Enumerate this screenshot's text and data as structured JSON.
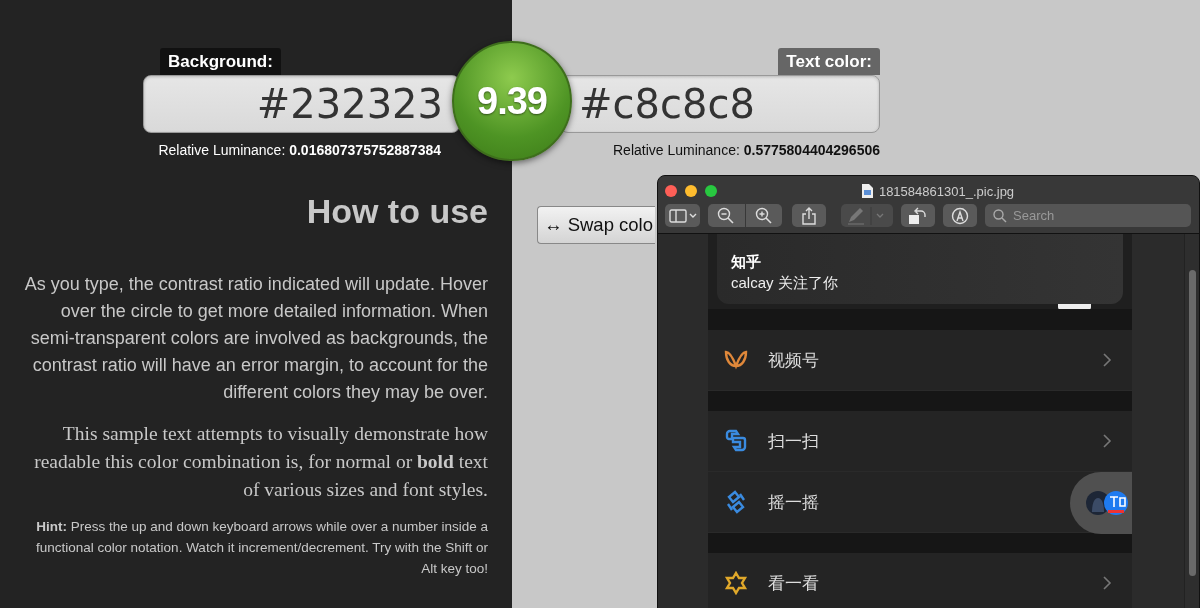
{
  "contrast": {
    "ratio": "9.39",
    "background": {
      "label": "Background:",
      "value": "#232323",
      "luminance": "Relative Luminance: **0.016807375752887384**"
    },
    "text_color": {
      "label": "Text color:",
      "value": "#c8c8c8",
      "luminance": "Relative Luminance: **0.5775804404296506**"
    }
  },
  "how_to_use": {
    "heading": "How to use",
    "paragraph": "As you type, the contrast ratio indicated will update. Hover over the circle to get more detailed information. When semi-transparent colors are involved as backgrounds, the contrast ratio will have an error margin, to account for the different colors they may be over.",
    "sample": "This sample text attempts to visually demonstrate how readable this color combination is, for normal or **bold** text of various sizes and font styles.",
    "hint": "**Hint:** Press the up and down keyboard arrows while over a number inside a functional color notation. Watch it increment/decrement. Try with the Shift or Alt key too!"
  },
  "swap_button": "↔ Swap colo",
  "preview_window": {
    "title": "181584861301_.pic.jpg",
    "toolbar": [
      {
        "kind": "sidebar",
        "disabled": false
      },
      {
        "kind": "zoom-out",
        "disabled": false
      },
      {
        "kind": "zoom-in",
        "disabled": false
      },
      {
        "kind": "share",
        "disabled": false
      },
      {
        "kind": "markup",
        "disabled": true
      },
      {
        "kind": "rotate",
        "disabled": false
      },
      {
        "kind": "annotate",
        "disabled": false
      }
    ],
    "search": {
      "placeholder": "Search"
    },
    "image": {
      "notification": {
        "title": "知乎",
        "message": "calcay 关注了你"
      },
      "menu": [
        {
          "label": "视频号",
          "kind": "channels",
          "color": "#e0883a",
          "chevron": true
        },
        {
          "label": "扫一扫",
          "kind": "scan",
          "color": "#3a8be0",
          "chevron": true
        },
        {
          "label": "摇一摇",
          "kind": "shake",
          "color": "#3a8be0",
          "chevron": false
        },
        {
          "label": "看一看",
          "kind": "look",
          "color": "#e0a82a",
          "chevron": true
        }
      ]
    }
  }
}
